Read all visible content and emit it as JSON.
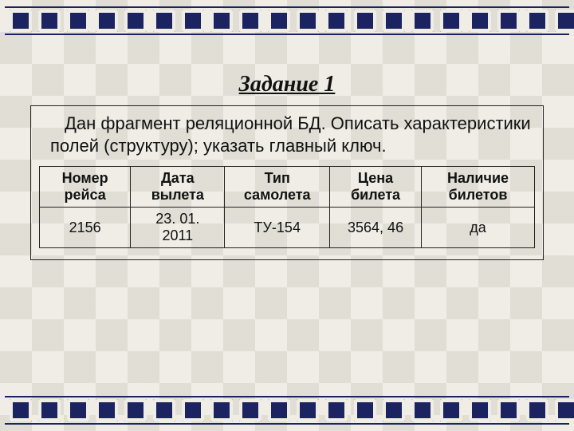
{
  "title": "Задание 1",
  "prompt": "Дан фрагмент реляционной БД. Описать характеристики полей (структуру); указать главный ключ.",
  "table": {
    "headers": [
      "Номер рейса",
      "Дата вылета",
      "Тип самолета",
      "Цена билета",
      "Наличие билетов"
    ],
    "rows": [
      [
        "2156",
        "23. 01. 2011",
        "ТУ-154",
        "3564, 46",
        "да"
      ]
    ]
  }
}
